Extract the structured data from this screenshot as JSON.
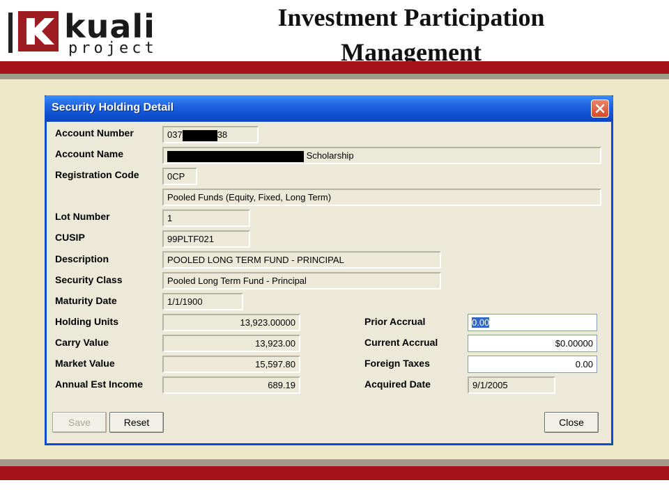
{
  "slide": {
    "logo_word": "kuali",
    "logo_sub": "project",
    "title_line1": "Investment Participation",
    "title_line2": "Management"
  },
  "window": {
    "title": "Security Holding Detail",
    "fields": {
      "account_number": {
        "label": "Account Number",
        "value_start": "037",
        "value_end": "38"
      },
      "account_name": {
        "label": "Account Name",
        "value_end": "Scholarship"
      },
      "registration_code": {
        "label": "Registration Code",
        "value": "0CP",
        "description": "Pooled Funds (Equity, Fixed, Long Term)"
      },
      "lot_number": {
        "label": "Lot Number",
        "value": "1"
      },
      "cusip": {
        "label": "CUSIP",
        "value": "99PLTF021"
      },
      "description": {
        "label": "Description",
        "value": "POOLED LONG TERM FUND - PRINCIPAL"
      },
      "security_class": {
        "label": "Security Class",
        "value": "Pooled Long Term Fund - Principal"
      },
      "maturity_date": {
        "label": "Maturity Date",
        "value": "1/1/1900"
      },
      "holding_units": {
        "label": "Holding Units",
        "value": "13,923.00000"
      },
      "carry_value": {
        "label": "Carry Value",
        "value": "13,923.00"
      },
      "market_value": {
        "label": "Market Value",
        "value": "15,597.80"
      },
      "annual_est_income": {
        "label": "Annual Est Income",
        "value": "689.19"
      },
      "prior_accrual": {
        "label": "Prior Accrual",
        "value": "0.00"
      },
      "current_accrual": {
        "label": "Current Accrual",
        "value": "$0.00000"
      },
      "foreign_taxes": {
        "label": "Foreign Taxes",
        "value": "0.00"
      },
      "acquired_date": {
        "label": "Acquired Date",
        "value": "9/1/2005"
      }
    },
    "buttons": {
      "save": "Save",
      "reset": "Reset",
      "close": "Close"
    }
  },
  "colors": {
    "brand_red": "#a5121a",
    "titlebar_blue": "#0a4ccf",
    "slide_background": "#ece8c8"
  }
}
